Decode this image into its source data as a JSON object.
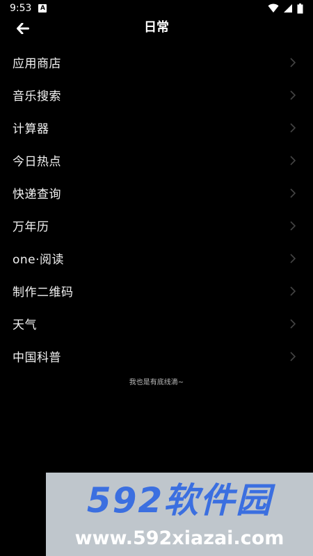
{
  "status_bar": {
    "time": "9:53",
    "notification_badge": "A",
    "icons": [
      "wifi-icon",
      "signal-icon",
      "battery-icon"
    ]
  },
  "header": {
    "title": "日常",
    "back_icon": "arrow-left-icon"
  },
  "menu": {
    "items": [
      {
        "label": "应用商店"
      },
      {
        "label": "音乐搜索"
      },
      {
        "label": "计算器"
      },
      {
        "label": "今日热点"
      },
      {
        "label": "快递查询"
      },
      {
        "label": "万年历"
      },
      {
        "label": "one·阅读"
      },
      {
        "label": "制作二维码"
      },
      {
        "label": "天气"
      },
      {
        "label": "中国科普"
      }
    ]
  },
  "footer_note": "我也是有底线滴~",
  "watermark": {
    "logo_text": "592软件园",
    "url_text": "www.592xiazai.com"
  },
  "colors": {
    "background": "#000000",
    "text": "#f2f2f2",
    "chevron": "#444444",
    "watermark_bg": "#bfc6cc",
    "watermark_logo": "#3b6fe0"
  }
}
